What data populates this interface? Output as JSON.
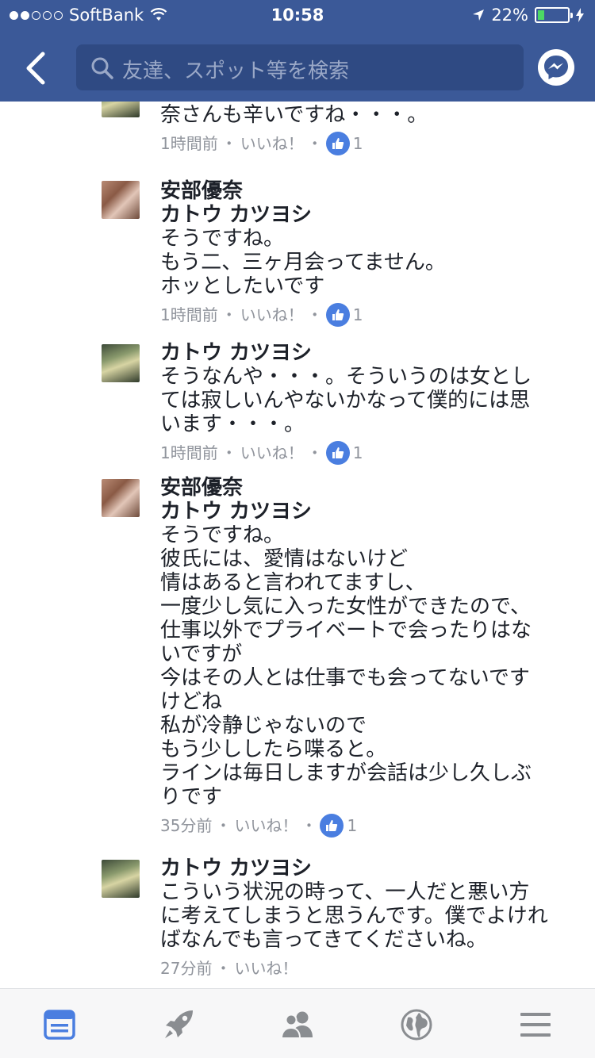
{
  "status_bar": {
    "carrier": "SoftBank",
    "time": "10:58",
    "battery": "22%",
    "battery_level": 0.22
  },
  "search": {
    "placeholder": "友達、スポット等を検索"
  },
  "comments": [
    {
      "name": "",
      "reply_to": "",
      "text": "そうなんですか・・・。そやったら優\n奈さんも辛いですね・・・。",
      "time": "1時間前",
      "sep1": "・",
      "like_label": "いいね！",
      "sep2": "・",
      "like_count": "1",
      "avatar": "man"
    },
    {
      "name": "安部優奈",
      "reply_to": "カトウ カツヨシ",
      "text": "そうですね。\nもう二、三ヶ月会ってません。\nホッとしたいです",
      "time": "1時間前",
      "sep1": "・",
      "like_label": "いいね！",
      "sep2": "・",
      "like_count": "1",
      "avatar": "woman"
    },
    {
      "name": "カトウ カツヨシ",
      "reply_to": "",
      "text": "そうなんや・・・。そういうのは女とし\nては寂しいんやないかなって僕的には思\nいます・・・。",
      "time": "1時間前",
      "sep1": "・",
      "like_label": "いいね！",
      "sep2": "・",
      "like_count": "1",
      "avatar": "man"
    },
    {
      "name": "安部優奈",
      "reply_to": "カトウ カツヨシ",
      "text": "そうですね。\n彼氏には、愛情はないけど\n情はあると言われてますし、\n一度少し気に入った女性ができたので、\n仕事以外でプライベートで会ったりはな\nいですが\n今はその人とは仕事でも会ってないです\nけどね\n私が冷静じゃないので\nもう少ししたら喋ると。\nラインは毎日しますが会話は少し久しぶ\nりです",
      "time": "35分前",
      "sep1": "・",
      "like_label": "いいね！",
      "sep2": "・",
      "like_count": "1",
      "avatar": "woman"
    },
    {
      "name": "カトウ カツヨシ",
      "reply_to": "",
      "text": "こういう状況の時って、一人だと悪い方\nに考えてしまうと思うんです。僕でよけれ\nばなんでも言ってきてくださいね。",
      "time": "27分前",
      "sep1": "・",
      "like_label": "いいね！",
      "sep2": "",
      "like_count": "",
      "avatar": "man"
    }
  ],
  "tabs": [
    {
      "icon": "news-feed-icon"
    },
    {
      "icon": "rocket-icon"
    },
    {
      "icon": "friends-icon"
    },
    {
      "icon": "globe-icon"
    },
    {
      "icon": "menu-icon"
    }
  ]
}
